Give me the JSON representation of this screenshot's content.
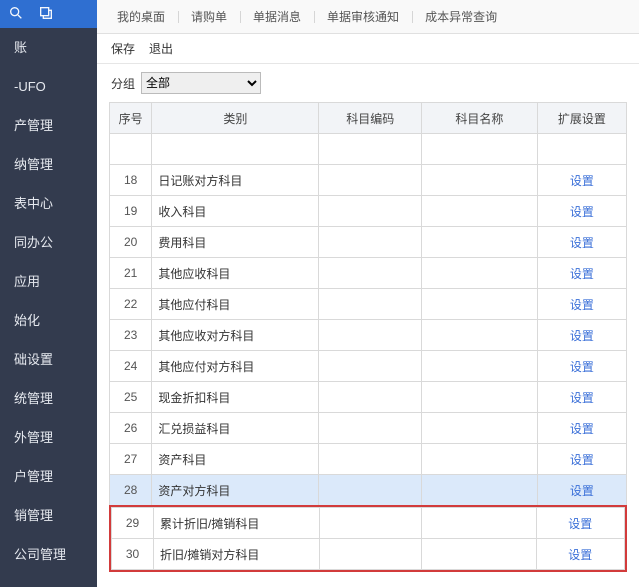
{
  "sidebar": {
    "items": [
      {
        "label": "账"
      },
      {
        "label": "-UFO"
      },
      {
        "label": "产管理"
      },
      {
        "label": "纳管理"
      },
      {
        "label": "表中心"
      },
      {
        "label": "同办公"
      },
      {
        "label": "应用"
      },
      {
        "label": "始化"
      },
      {
        "label": "础设置"
      },
      {
        "label": "统管理"
      },
      {
        "label": "外管理"
      },
      {
        "label": "户管理"
      },
      {
        "label": "销管理"
      },
      {
        "label": "公司管理"
      }
    ]
  },
  "tabs": [
    {
      "label": "我的桌面"
    },
    {
      "label": "请购单"
    },
    {
      "label": "单据消息"
    },
    {
      "label": "单据审核通知"
    },
    {
      "label": "成本异常查询"
    }
  ],
  "toolbar": {
    "save": "保存",
    "exit": "退出"
  },
  "filter": {
    "label": "分组",
    "value": "全部"
  },
  "columns": {
    "idx": "序号",
    "cat": "类别",
    "code": "科目编码",
    "name": "科目名称",
    "ext": "扩展设置"
  },
  "setting_label": "设置",
  "rows": [
    {
      "idx": "",
      "cat": "",
      "selected": false,
      "showSet": false
    },
    {
      "idx": "18",
      "cat": "日记账对方科目",
      "selected": false,
      "showSet": true
    },
    {
      "idx": "19",
      "cat": "收入科目",
      "selected": false,
      "showSet": true
    },
    {
      "idx": "20",
      "cat": "费用科目",
      "selected": false,
      "showSet": true
    },
    {
      "idx": "21",
      "cat": "其他应收科目",
      "selected": false,
      "showSet": true
    },
    {
      "idx": "22",
      "cat": "其他应付科目",
      "selected": false,
      "showSet": true
    },
    {
      "idx": "23",
      "cat": "其他应收对方科目",
      "selected": false,
      "showSet": true
    },
    {
      "idx": "24",
      "cat": "其他应付对方科目",
      "selected": false,
      "showSet": true
    },
    {
      "idx": "25",
      "cat": "现金折扣科目",
      "selected": false,
      "showSet": true
    },
    {
      "idx": "26",
      "cat": "汇兑损益科目",
      "selected": false,
      "showSet": true
    },
    {
      "idx": "27",
      "cat": "资产科目",
      "selected": false,
      "showSet": true
    },
    {
      "idx": "28",
      "cat": "资产对方科目",
      "selected": true,
      "showSet": true
    }
  ],
  "highlight_rows": [
    {
      "idx": "29",
      "cat": "累计折旧/摊销科目",
      "showSet": true
    },
    {
      "idx": "30",
      "cat": "折旧/摊销对方科目",
      "showSet": true
    }
  ]
}
